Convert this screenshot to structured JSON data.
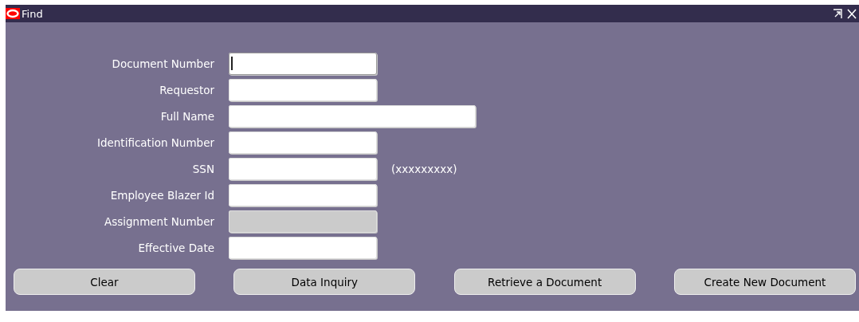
{
  "window": {
    "title": "Find"
  },
  "fields": [
    {
      "label": "Document Number",
      "kind": "normal",
      "disabled": false,
      "focused": true
    },
    {
      "label": "Requestor",
      "kind": "normal",
      "disabled": false,
      "focused": false
    },
    {
      "label": "Full Name",
      "kind": "wide",
      "disabled": false,
      "focused": false
    },
    {
      "label": "Identification Number",
      "kind": "normal",
      "disabled": false,
      "focused": false
    },
    {
      "label": "SSN",
      "kind": "normal",
      "disabled": false,
      "focused": false,
      "hint": "(xxxxxxxxx)"
    },
    {
      "label": "Employee Blazer Id",
      "kind": "normal",
      "disabled": false,
      "focused": false
    },
    {
      "label": "Assignment Number",
      "kind": "normal",
      "disabled": true,
      "focused": false
    },
    {
      "label": "Effective Date",
      "kind": "normal",
      "disabled": false,
      "focused": false
    }
  ],
  "buttons": [
    "Clear",
    "Data Inquiry",
    "Retrieve a Document",
    "Create New Document"
  ]
}
